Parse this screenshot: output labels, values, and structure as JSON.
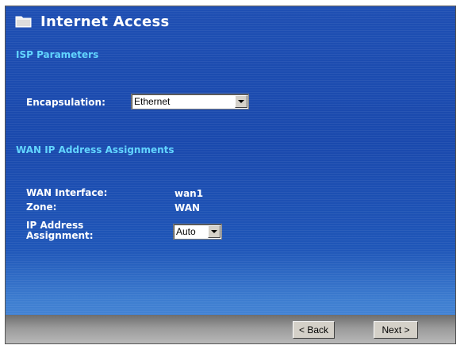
{
  "window": {
    "title": "Internet Access",
    "icon": "folder-icon"
  },
  "isp": {
    "section_title": "ISP Parameters",
    "encapsulation_label": "Encapsulation:",
    "encapsulation_value": "Ethernet"
  },
  "wan": {
    "section_title": "WAN IP Address Assignments",
    "interface_label": "WAN Interface:",
    "interface_value": "wan1",
    "zone_label": "Zone:",
    "zone_value": "WAN",
    "ip_assignment_label_line1": "IP Address",
    "ip_assignment_label_line2": "Assignment:",
    "ip_assignment_value": "Auto"
  },
  "footer": {
    "back_label": "< Back",
    "next_label": "Next >"
  },
  "colors": {
    "section_title": "#5fd4ff",
    "background": "#1e4fb3"
  }
}
